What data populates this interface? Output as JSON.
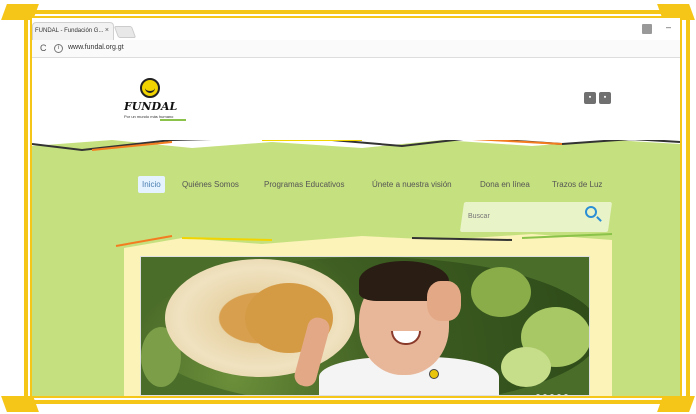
{
  "browser": {
    "tab_title": "FUNDAL - Fundación G...",
    "tab_close": "×",
    "url": "www.fundal.org.gt",
    "reload_icon": "reload-icon",
    "info_icon": "info-icon"
  },
  "logo": {
    "name": "FUNDAL",
    "tagline": "Por un mundo más humano"
  },
  "social": {
    "icons": [
      "social-icon-1",
      "social-icon-2"
    ]
  },
  "nav": {
    "items": [
      {
        "label": "Inicio",
        "active": true
      },
      {
        "label": "Quiénes Somos",
        "active": false
      },
      {
        "label": "Programas Educativos",
        "active": false
      },
      {
        "label": "Únete a nuestra visión",
        "active": false
      },
      {
        "label": "Dona en línea",
        "active": false
      },
      {
        "label": "Trazos de Luz",
        "active": false
      }
    ]
  },
  "search": {
    "placeholder": "Buscar"
  },
  "colors": {
    "frame": "#f5c518",
    "page_green": "#c5e07e",
    "content_yellow": "#fbf3b8",
    "accent_blue": "#2b8fd6"
  }
}
